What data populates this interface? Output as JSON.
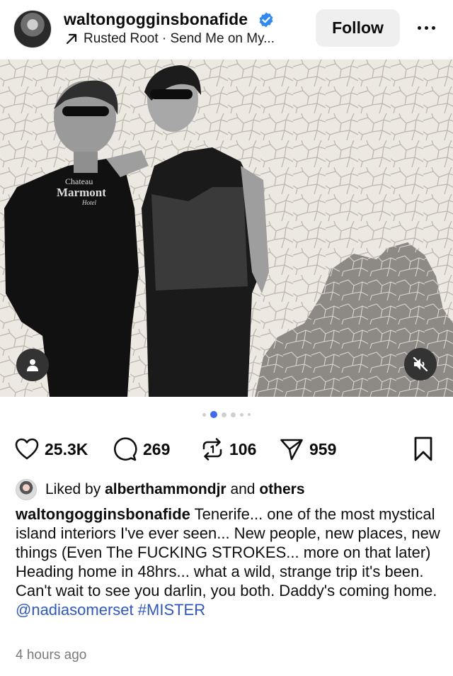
{
  "post": {
    "username": "waltongogginsbonafide",
    "verified": true,
    "music": {
      "icon": "arrow-up-right-icon",
      "text": "Rusted Root · Send Me on My..."
    },
    "follow_label": "Follow",
    "more_icon": "more-horizontal-icon"
  },
  "media": {
    "shirt_text_line1": "Chateau",
    "shirt_text_line2": "Marmont",
    "shirt_text_line3": "Hotel",
    "tag_icon": "user-tag-icon",
    "mute_icon": "speaker-muted-icon",
    "carousel": {
      "count": 6,
      "active_index": 1
    }
  },
  "actions": {
    "likes": "25.3K",
    "comments": "269",
    "reposts": "106",
    "shares": "959"
  },
  "liked_by": {
    "prefix": "Liked by",
    "user": "alberthammondjr",
    "and": "and",
    "others": "others"
  },
  "caption": {
    "user": "waltongogginsbonafide",
    "body": "Tenerife... one of the most mystical island interiors I've ever seen... New people, new places, new things (Even The FUCKING STROKES... more on that later) Heading home in 48hrs... what a wild, strange trip it's been. Can't wait to see you darlin, you both. Daddy's coming home.",
    "mention": "@nadiasomerset",
    "hashtag": "#MISTER"
  },
  "timestamp": "4 hours ago",
  "colors": {
    "accent_blue": "#3f6bf0",
    "link_blue": "#2e56c7",
    "follow_bg": "#efefef",
    "timestamp_gray": "#7a7a7a"
  }
}
